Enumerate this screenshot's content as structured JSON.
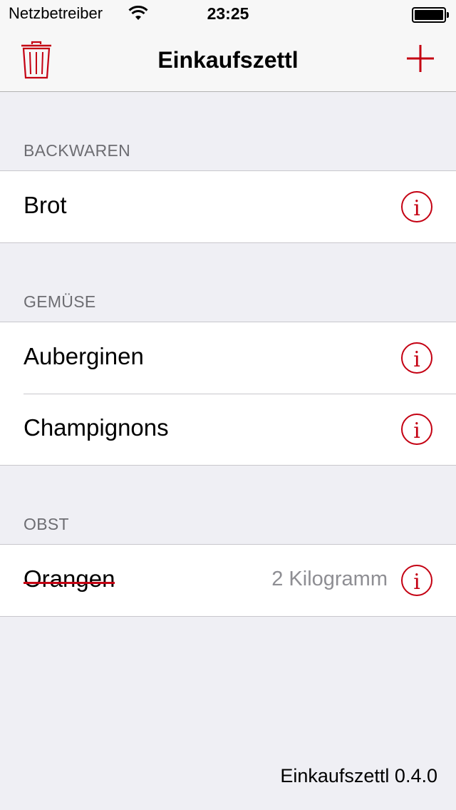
{
  "status_bar": {
    "carrier": "Netzbetreiber",
    "time": "23:25"
  },
  "nav": {
    "title": "Einkaufszettl",
    "left_icon": "trash-icon",
    "right_icon": "plus-icon"
  },
  "accent_color": "#c40012",
  "sections": [
    {
      "header": "BACKWAREN",
      "items": [
        {
          "name": "Brot",
          "detail": "",
          "done": false
        }
      ]
    },
    {
      "header": "GEMÜSE",
      "items": [
        {
          "name": "Auberginen",
          "detail": "",
          "done": false
        },
        {
          "name": "Champignons",
          "detail": "",
          "done": false
        }
      ]
    },
    {
      "header": "OBST",
      "items": [
        {
          "name": "Orangen",
          "detail": "2 Kilogramm",
          "done": true
        }
      ]
    }
  ],
  "footer": {
    "version_text": "Einkaufszettl 0.4.0"
  }
}
